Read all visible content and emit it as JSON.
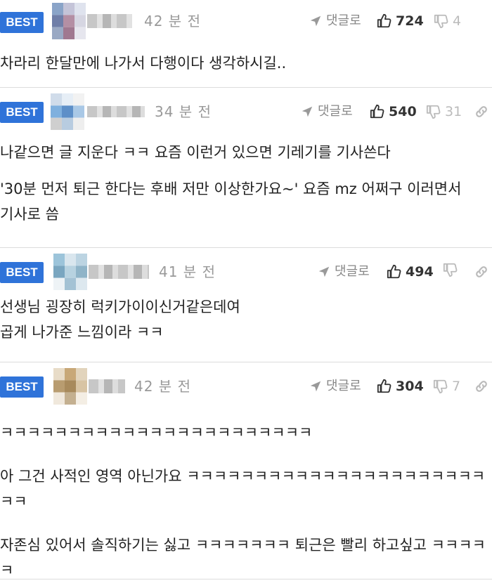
{
  "comments": [
    {
      "badge": "BEST",
      "time": "42 분 전",
      "reply_label": "댓글로",
      "likes": "724",
      "dislikes": "4",
      "avatar_colors": [
        "#8aa4c8",
        "#c4c4d8",
        "#6f7ea8",
        "#b48fa4",
        "#d6d6e2",
        "#9aa9c4"
      ],
      "paragraphs": [
        "차라리 한달만에 나가서 다행이다 생각하시길.."
      ]
    },
    {
      "badge": "BEST",
      "time": "34 분 전",
      "reply_label": "댓글로",
      "likes": "540",
      "dislikes": "31",
      "avatar_colors": [
        "#7fb0de",
        "#d8e6f2",
        "#5d8fc8",
        "#a9c8e6",
        "#e6eef6",
        "#cfcfcf"
      ],
      "paragraphs": [
        "나같으면 글 지운다 ㅋㅋ 요즘 이런거 있으면 기레기를 기사쓴다",
        "'30분 먼저 퇴근 한다는 후배 저만 이상한가요~' 요즘 mz 어쩌구 이러면서 기사로 씀"
      ]
    },
    {
      "badge": "BEST",
      "time": "41 분 전",
      "reply_label": "댓글로",
      "likes": "494",
      "dislikes": "",
      "avatar_colors": [
        "#9cc4da",
        "#d9e6ee",
        "#7aa6c0",
        "#b7d2e0",
        "#eef3f6",
        "#8fb4c8"
      ],
      "paragraphs": [
        "선생님 굉장히 럭키가이이신거같은데여\n곱게 나가준 느낌이라 ㅋㅋ"
      ]
    },
    {
      "badge": "BEST",
      "time": "42 분 전",
      "reply_label": "댓글로",
      "likes": "304",
      "dislikes": "7",
      "avatar_colors": [
        "#c8a878",
        "#e8dcc8",
        "#a88a5c",
        "#d8c4a4",
        "#f0e8dc",
        "#b89c70"
      ],
      "paragraphs": [
        "ㅋㅋㅋㅋㅋㅋㅋㅋㅋㅋㅋㅋㅋㅋㅋㅋㅋㅋㅋㅋㅋㅋㅋ",
        "아 그건 사적인 영역 아닌가요 ㅋㅋㅋㅋㅋㅋㅋㅋㅋㅋㅋㅋㅋㅋㅋㅋㅋㅋㅋㅋㅋㅋㅋㅋ",
        "자존심 있어서 솔직하기는 싫고 ㅋㅋㅋㅋㅋㅋㅋ 퇴근은 빨리 하고싶고 ㅋㅋㅋㅋㅋ"
      ]
    }
  ],
  "colors": {
    "badge": "#2f73d9",
    "meta_text": "#999999",
    "like_text": "#333333"
  },
  "icons": {
    "reply": "send-arrow-icon",
    "like": "thumbs-up-icon",
    "dislike": "thumbs-down-icon",
    "link": "link-icon"
  }
}
